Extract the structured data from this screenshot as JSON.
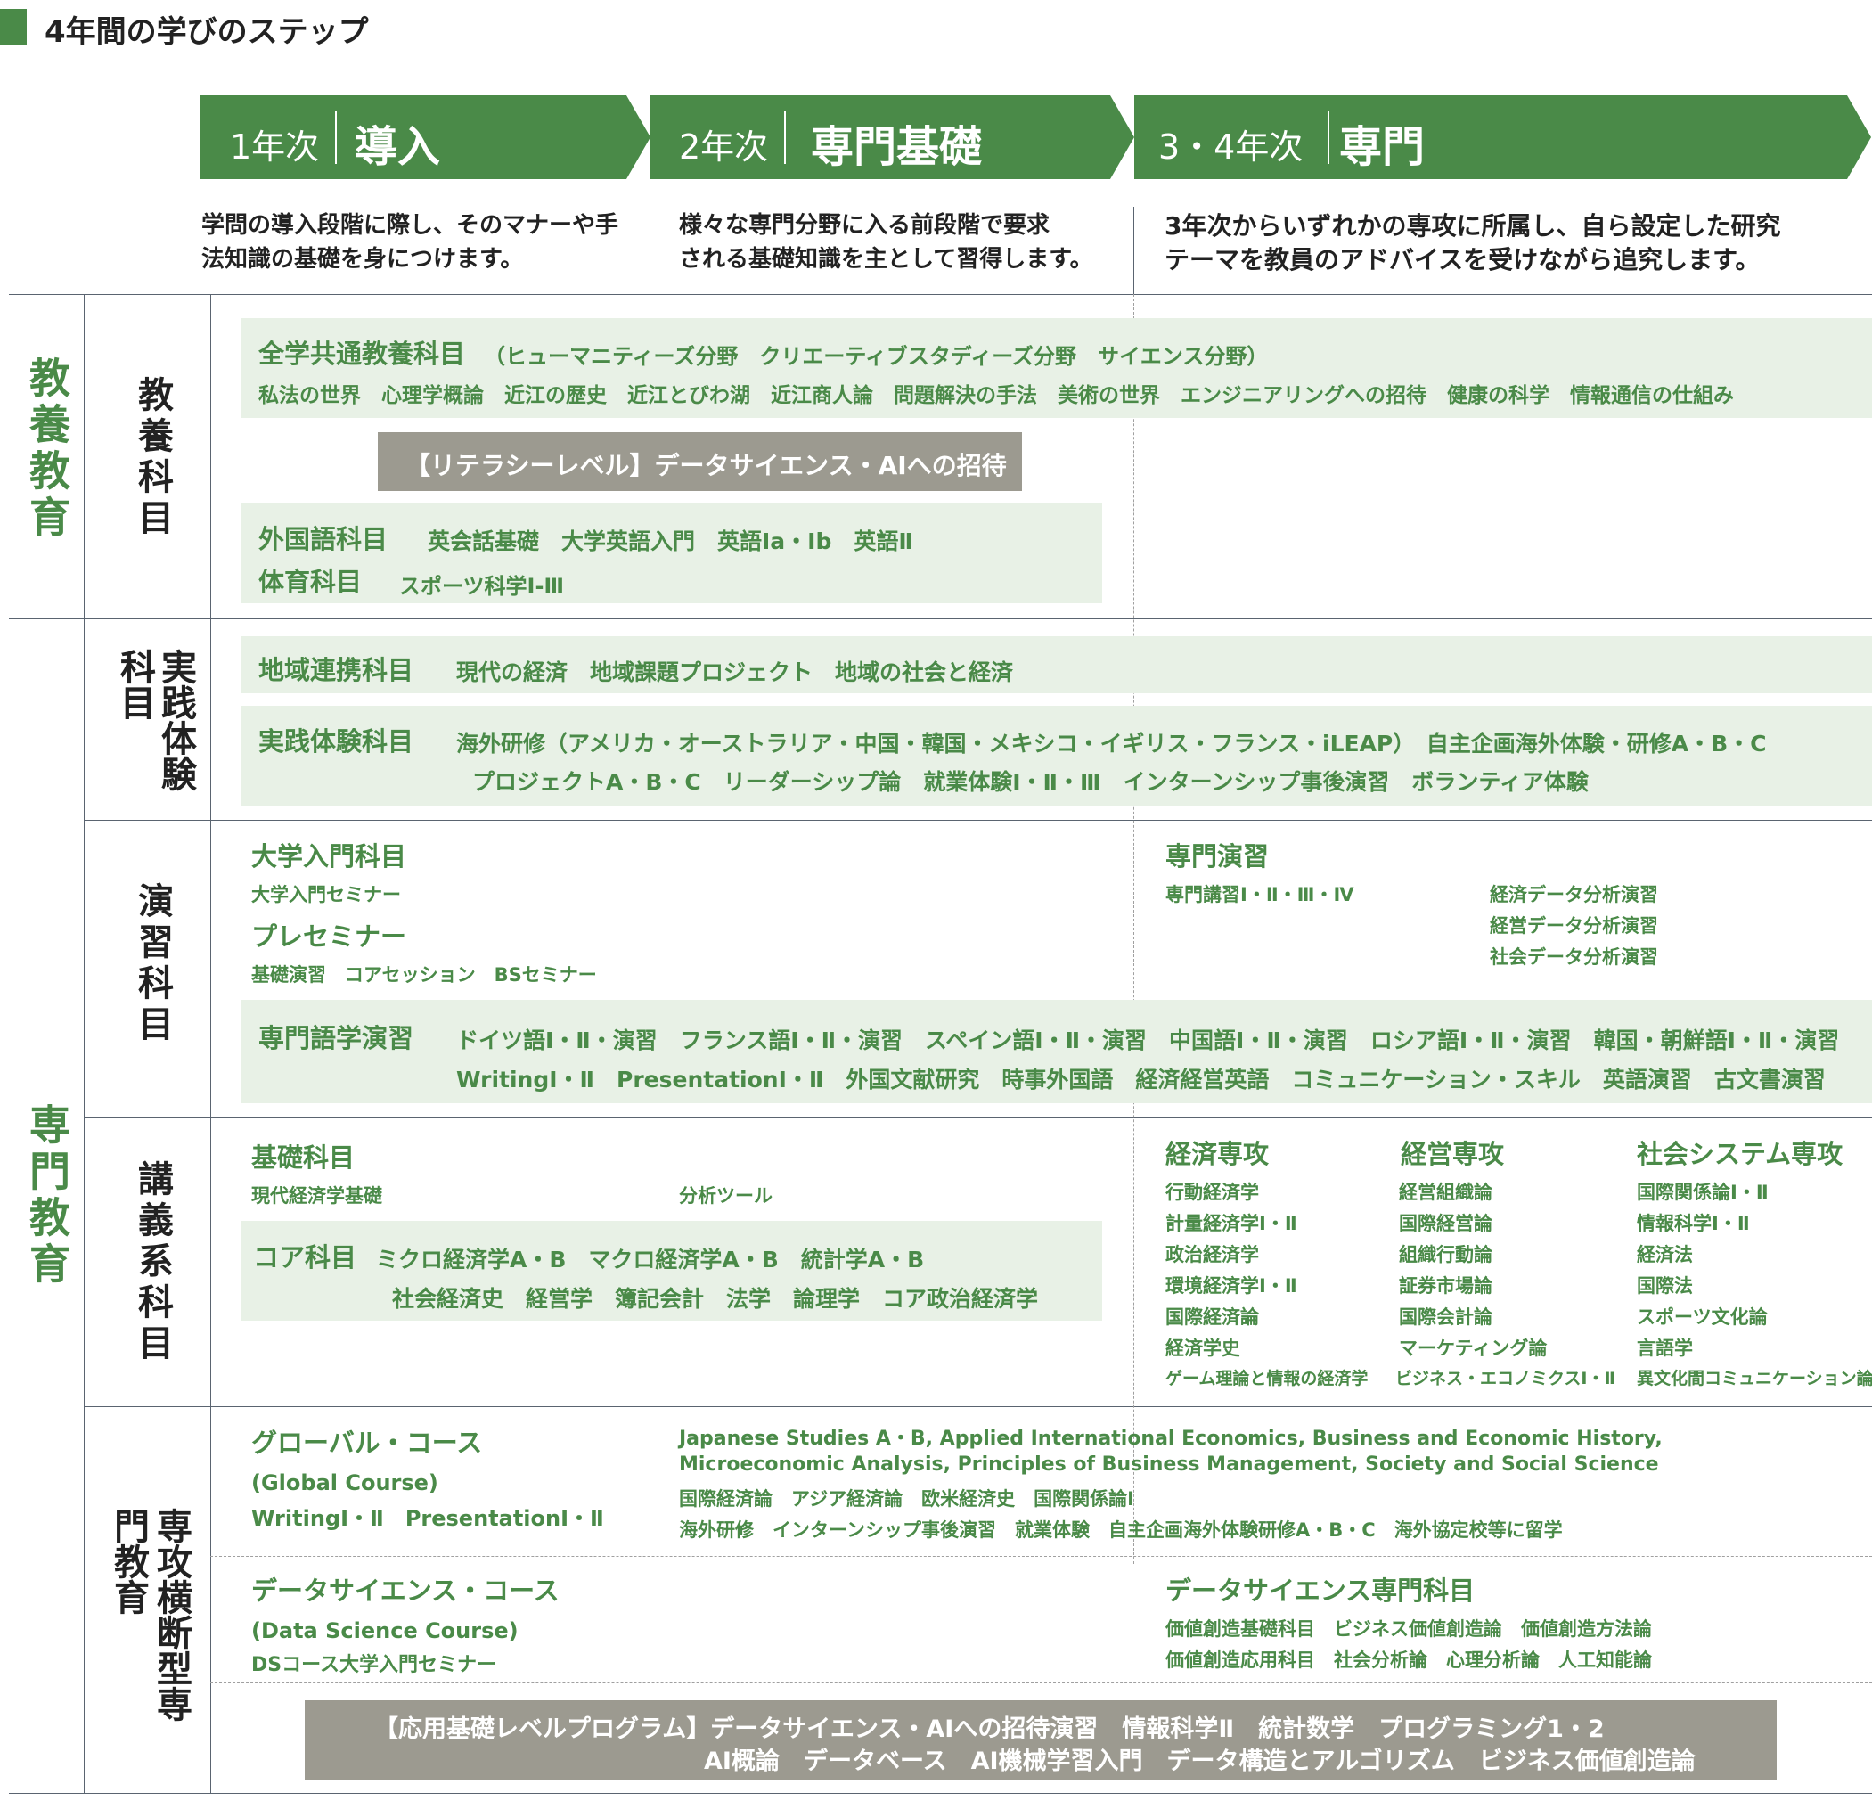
{
  "title": "4年間の学びのステップ",
  "colors": {
    "green": "#4a8a48",
    "light_green": "#e8f1e6",
    "gray_box": "#9c9a90",
    "line": "#5a6470"
  },
  "steps": [
    {
      "year": "1年次",
      "name": "導入",
      "desc1": "学問の導入段階に際し、そのマナーや手",
      "desc2": "法知識の基礎を身につけます。"
    },
    {
      "year": "2年次",
      "name": "専門基礎",
      "desc1": "様々な専門分野に入る前段階で要求",
      "desc2": "される基礎知識を主として習得します。"
    },
    {
      "year": "3・4年次",
      "name": "専門",
      "desc1": "3年次からいずれかの専攻に所属し、自ら設定した研究",
      "desc2": "テーマを教員のアドバイスを受けながら追究します。"
    }
  ],
  "left_labels": {
    "kyoyo": "教養教育",
    "senmon": "専門教育"
  },
  "sections": {
    "kyoyo_kamoku": "教養科目",
    "jissen": "実践体験科目",
    "enshu": "演習科目",
    "kogi": "講義系科目",
    "senmon_oudan": "専攻横断型専門教育"
  },
  "kyoyo": {
    "zengaku_title": "全学共通教養科目",
    "zengaku_fields": "（ヒューマニティーズ分野　クリエーティブスタディーズ分野　サイエンス分野）",
    "zengaku_items": "私法の世界　心理学概論　近江の歴史　近江とびわ湖　近江商人論　問題解決の手法　美術の世界　エンジニアリングへの招待　健康の科学　情報通信の仕組み",
    "literacy": "【リテラシーレベル】データサイエンス・AIへの招待",
    "gaikokugo_title": "外国語科目",
    "gaikokugo_items": "英会話基礎　大学英語入門　英語Ⅰa・Ⅰb　英語Ⅱ",
    "taiiku_title": "体育科目",
    "taiiku_items": "スポーツ科学Ⅰ-Ⅲ"
  },
  "jissen": {
    "chiiki_title": "地域連携科目",
    "chiiki_items": "現代の経済　地域課題プロジェクト　地域の社会と経済",
    "jissen_title": "実践体験科目",
    "jissen_items1": "海外研修（アメリカ・オーストラリア・中国・韓国・メキシコ・イギリス・フランス・iLEAP）　自主企画海外体験・研修A・B・C",
    "jissen_items2": "プロジェクトA・B・C　リーダーシップ論　就業体験Ⅰ・Ⅱ・Ⅲ　インターンシップ事後演習　ボランティア体験"
  },
  "enshu": {
    "daigaku_title": "大学入門科目",
    "daigaku_item": "大学入門セミナー",
    "presemi_title": "プレセミナー",
    "presemi_items": "基礎演習　コアセッション　BSセミナー",
    "senmon_enshu_title": "専門演習",
    "senmon_enshu_item": "専門講習Ⅰ・Ⅱ・Ⅲ・Ⅳ",
    "data_enshu": [
      "経済データ分析演習",
      "経営データ分析演習",
      "社会データ分析演習"
    ],
    "gogaku_title": "専門語学演習",
    "gogaku_items1": "ドイツ語Ⅰ・Ⅱ・演習　フランス語Ⅰ・Ⅱ・演習　スペイン語Ⅰ・Ⅱ・演習　中国語Ⅰ・Ⅱ・演習　ロシア語Ⅰ・Ⅱ・演習　韓国・朝鮮語Ⅰ・Ⅱ・演習",
    "gogaku_items2": "WritingⅠ・Ⅱ　PresentationⅠ・Ⅱ　外国文献研究　時事外国語　経済経営英語　コミュニケーション・スキル　英語演習　古文書演習"
  },
  "kogi": {
    "kiso_title": "基礎科目",
    "kiso_item": "現代経済学基礎",
    "bunseki": "分析ツール",
    "core_title": "コア科目",
    "core_items1": "ミクロ経済学A・B　マクロ経済学A・B　統計学A・B",
    "core_items2": "社会経済史　経営学　簿記会計　法学　論理学　コア政治経済学",
    "majors": [
      {
        "title": "経済専攻",
        "items": [
          "行動経済学",
          "計量経済学Ⅰ・Ⅱ",
          "政治経済学",
          "環境経済学Ⅰ・Ⅱ",
          "国際経済論",
          "経済学史",
          "ゲーム理論と情報の経済学"
        ]
      },
      {
        "title": "経営専攻",
        "items": [
          "経営組織論",
          "国際経営論",
          "組織行動論",
          "証券市場論",
          "国際会計論",
          "マーケティング論",
          "ビジネス・エコノミクスⅠ・Ⅱ"
        ]
      },
      {
        "title": "社会システム専攻",
        "items": [
          "国際関係論Ⅰ・Ⅱ",
          "情報科学Ⅰ・Ⅱ",
          "経済法",
          "国際法",
          "スポーツ文化論",
          "言語学",
          "異文化間コミュニケーション論"
        ]
      }
    ]
  },
  "oudan": {
    "global_title": "グローバル・コース",
    "global_en": "(Global Course)",
    "global_items": "WritingⅠ・Ⅱ　PresentationⅠ・Ⅱ",
    "global_right1": "Japanese Studies A・B, Applied International Economics, Business and Economic History,",
    "global_right2": "Microeconomic Analysis, Principles of Business Management, Society and Social Science",
    "global_right3": "国際経済論　アジア経済論　欧米経済史　国際関係論Ⅰ",
    "global_right4": "海外研修　インターンシップ事後演習　就業体験　自主企画海外体験研修A・B・C　海外協定校等に留学",
    "ds_title": "データサイエンス・コース",
    "ds_en": "(Data Science Course)",
    "ds_item": "DSコース大学入門セミナー",
    "ds_senmon_title": "データサイエンス専門科目",
    "ds_senmon1": "価値創造基礎科目　ビジネス価値創造論　価値創造方法論",
    "ds_senmon2": "価値創造応用科目　社会分析論　心理分析論　人工知能論",
    "oyo1": "【応用基礎レベルプログラム】データサイエンス・AIへの招待演習　情報科学Ⅱ　統計数学　プログラミング1・2",
    "oyo2": "AI概論　データベース　AI機械学習入門　データ構造とアルゴリズム　ビジネス価値創造論"
  }
}
